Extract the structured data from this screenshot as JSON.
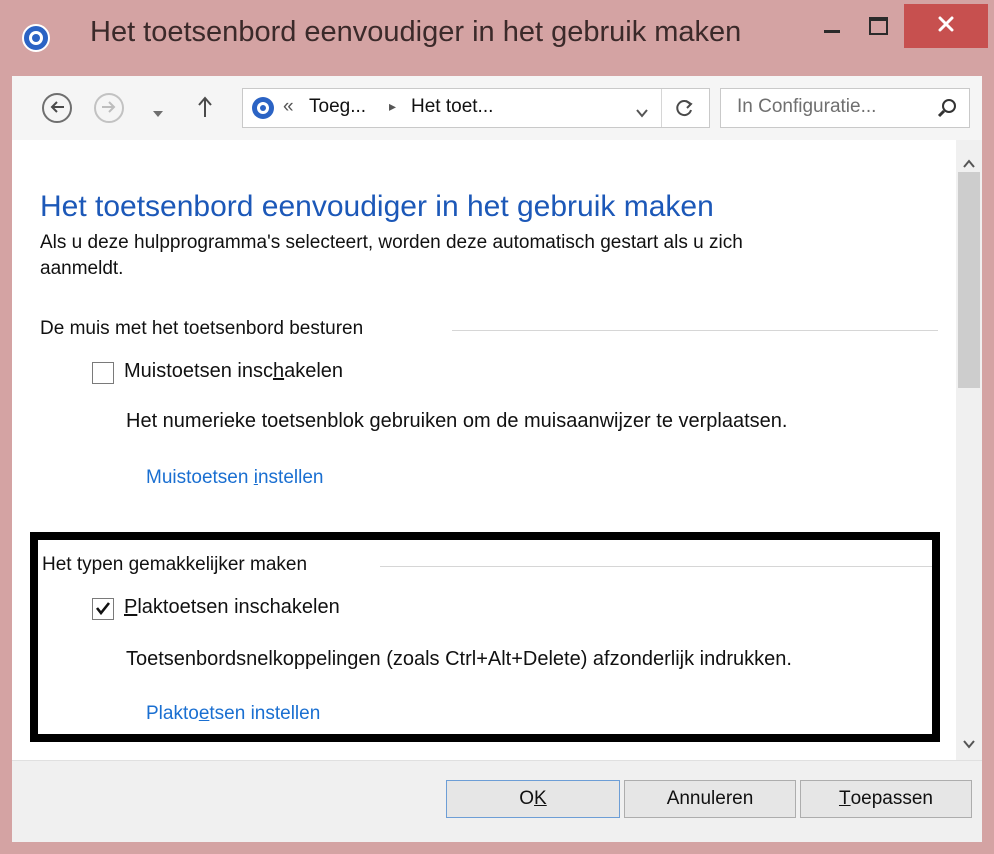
{
  "window": {
    "title": "Het toetsenbord eenvoudiger in het gebruik maken"
  },
  "nav": {
    "breadcrumb_prefix": "«",
    "breadcrumb_1": "Toeg...",
    "breadcrumb_sep": "▸",
    "breadcrumb_2": "Het toet...",
    "search_placeholder": "In Configuratie..."
  },
  "main": {
    "heading": "Het toetsenbord eenvoudiger in het gebruik maken",
    "intro_line1": "Als u deze hulpprogramma's selecteert, worden deze automatisch gestart als u zich",
    "intro_line2": "aanmeldt."
  },
  "mouse_section": {
    "title": "De muis met het toetsenbord besturen",
    "checkbox_pre": "Muistoetsen insc",
    "checkbox_access": "h",
    "checkbox_post": "akelen",
    "checked": false,
    "description": "Het numerieke toetsenblok gebruiken om de muisaanwijzer te verplaatsen.",
    "link_pre": "Muistoetsen ",
    "link_access": "i",
    "link_post": "nstellen"
  },
  "typing_section": {
    "title": "Het typen gemakkelijker maken",
    "checkbox_access": "P",
    "checkbox_post": "laktoetsen inschakelen",
    "checked": true,
    "description": "Toetsenbordsnelkoppelingen (zoals Ctrl+Alt+Delete) afzonderlijk indrukken.",
    "link_pre": "Plakto",
    "link_access": "e",
    "link_post": "tsen instellen"
  },
  "footer": {
    "ok_pre": "O",
    "ok_access": "K",
    "cancel": "Annuleren",
    "apply_access": "T",
    "apply_post": "oepassen"
  },
  "colors": {
    "titlebar": "#d4a3a3",
    "close_button": "#c7504f",
    "link": "#1a6fd1",
    "heading": "#1c58b8",
    "highlight_border": "#000000"
  },
  "icons": [
    "control-panel-icon",
    "minimize-icon",
    "maximize-icon",
    "close-icon",
    "back-icon",
    "forward-icon",
    "recent-pages-icon",
    "up-icon",
    "location-icon",
    "dropdown-icon",
    "refresh-icon",
    "search-icon",
    "scroll-up-icon",
    "scroll-down-icon",
    "checkmark-icon"
  ]
}
